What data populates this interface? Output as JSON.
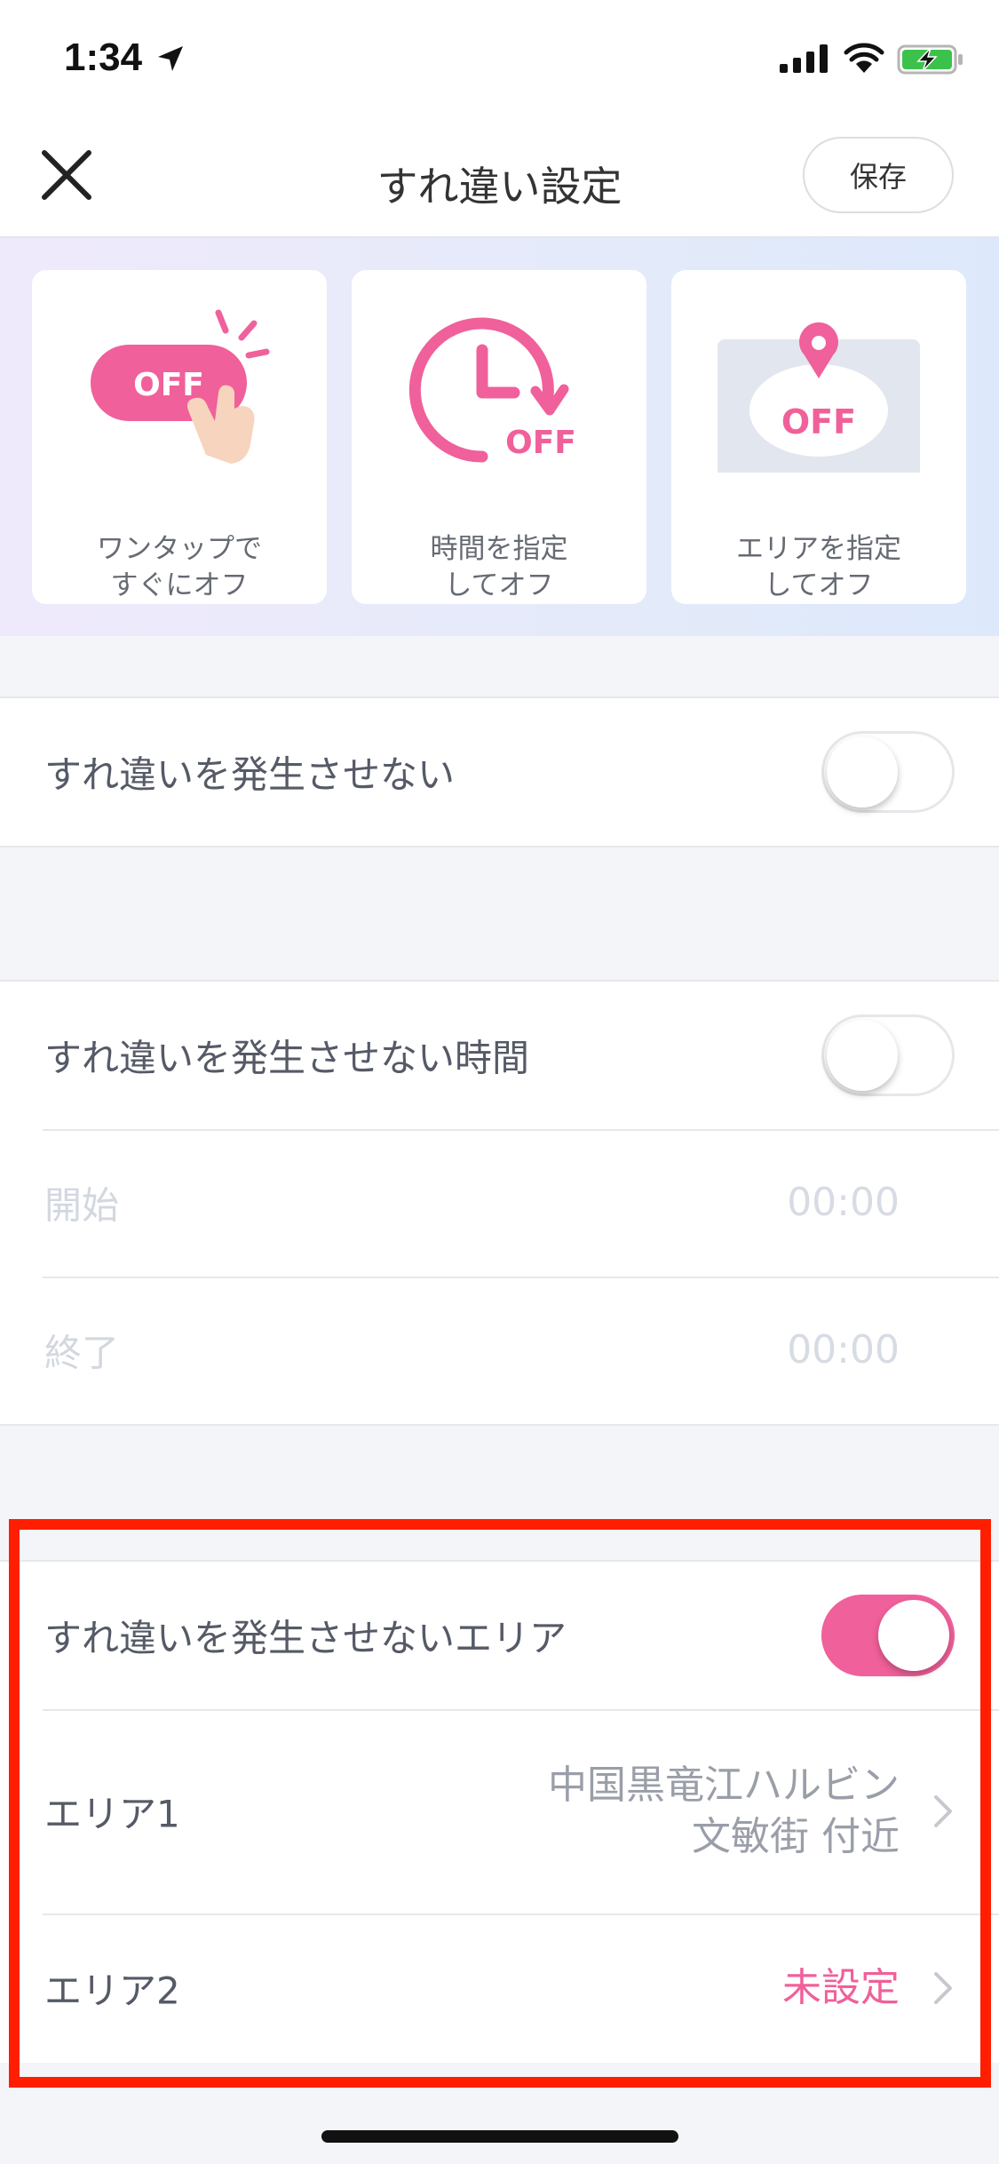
{
  "status": {
    "time": "1:34"
  },
  "header": {
    "title": "すれ違い設定",
    "save_label": "保存"
  },
  "banner": {
    "cards": [
      {
        "icon_text": "OFF",
        "line1": "ワンタップで",
        "line2": "すぐにオフ"
      },
      {
        "icon_text": "OFF",
        "line1": "時間を指定",
        "line2": "してオフ"
      },
      {
        "icon_text": "OFF",
        "line1": "エリアを指定",
        "line2": "してオフ"
      }
    ]
  },
  "settings": {
    "disable_all": {
      "label": "すれ違いを発生させない",
      "on": false
    },
    "disable_time": {
      "label": "すれ違いを発生させない時間",
      "on": false,
      "start_label": "開始",
      "start_value": "00:00",
      "end_label": "終了",
      "end_value": "00:00"
    },
    "disable_area": {
      "label": "すれ違いを発生させないエリア",
      "on": true,
      "area1_label": "エリア1",
      "area1_value_line1": "中国黒竜江ハルビン",
      "area1_value_line2": "文敏街 付近",
      "area2_label": "エリア2",
      "area2_value": "未設定"
    }
  },
  "colors": {
    "accent_pink": "#f0609a",
    "highlight_red": "#ff1e00"
  }
}
